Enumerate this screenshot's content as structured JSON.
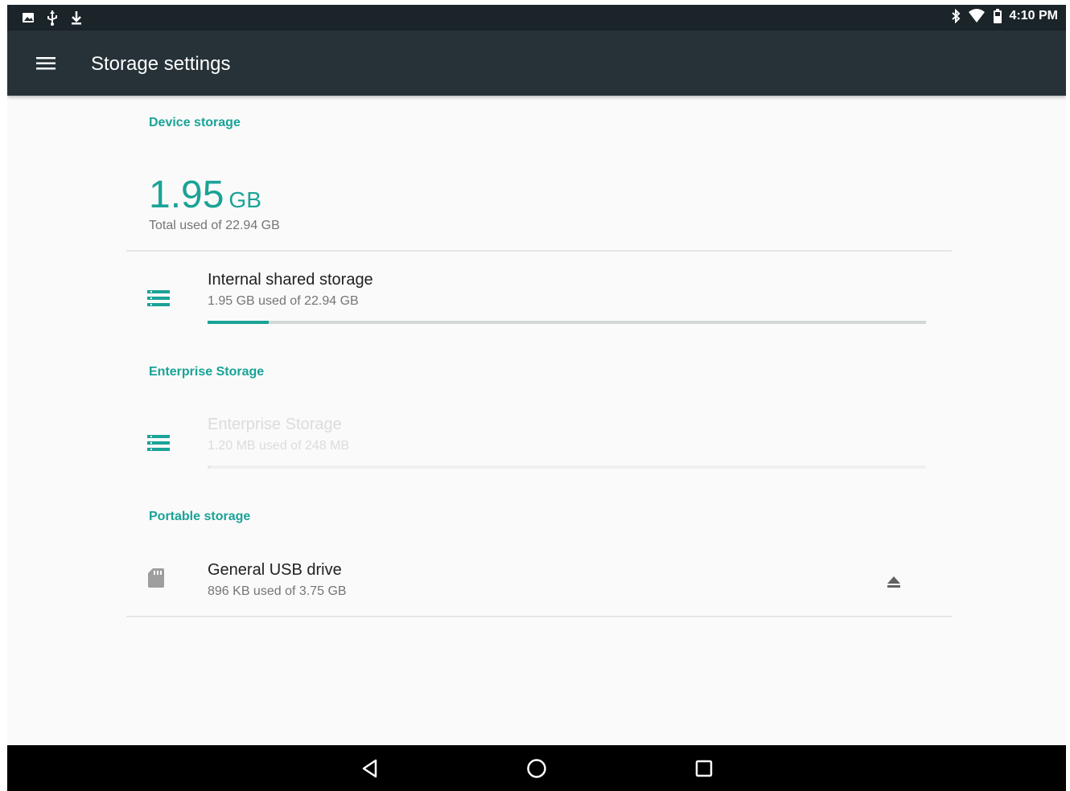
{
  "status_bar": {
    "time": "4:10 PM",
    "left_icons": [
      "image-notification-icon",
      "usb-icon",
      "download-icon"
    ],
    "right_icons": [
      "bluetooth-icon",
      "wifi-icon",
      "battery-icon"
    ]
  },
  "app_bar": {
    "title": "Storage settings",
    "menu_icon": "menu-icon"
  },
  "device_storage": {
    "header": "Device storage",
    "used_value": "1.95",
    "used_unit": "GB",
    "total_text": "Total used of 22.94 GB"
  },
  "internal": {
    "title": "Internal shared storage",
    "subtitle": "1.95 GB used of 22.94 GB",
    "progress": 0.085,
    "icon": "storage-list-icon"
  },
  "enterprise": {
    "header": "Enterprise Storage",
    "title": "Enterprise Storage",
    "subtitle": "1.20 MB used of 248 MB",
    "progress": 0.005,
    "icon": "storage-list-icon"
  },
  "portable": {
    "header": "Portable storage",
    "title": "General USB drive",
    "subtitle": "896 KB used of 3.75 GB",
    "icon": "sd-card-icon",
    "action_icon": "eject-icon"
  },
  "nav_bar": {
    "buttons": [
      "back-icon",
      "home-icon",
      "recents-icon"
    ]
  },
  "colors": {
    "accent": "#1aa397",
    "app_bar": "#263238",
    "status_bar": "#1b2429",
    "background": "#fafafa"
  }
}
